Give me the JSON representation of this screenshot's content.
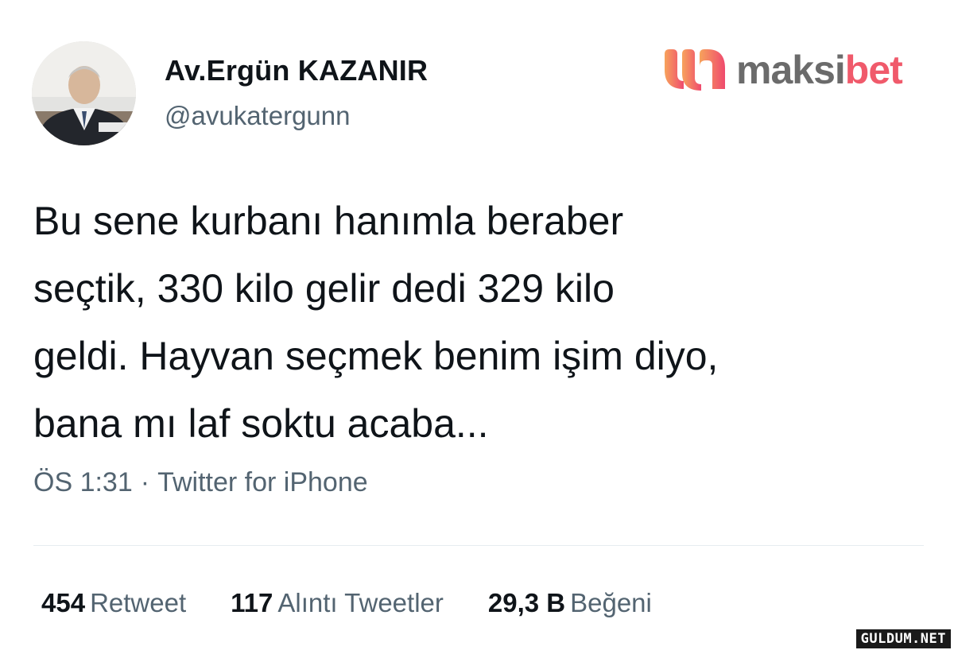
{
  "tweet": {
    "author": {
      "display_name": "Av.Ergün KAZANIR",
      "handle": "@avukatergunn"
    },
    "text": "Bu sene kurbanı hanımla beraber\nseçtik, 330 kilo gelir dedi 329 kilo\ngeldi. Hayvan seçmek benim işim diyo,\nbana mı laf soktu acaba...",
    "time": "ÖS 1:31",
    "separator": "·",
    "source": "Twitter for iPhone",
    "stats": {
      "retweets": {
        "count": "454",
        "label": "Retweet"
      },
      "quotes": {
        "count": "117",
        "label": "Alıntı Tweetler"
      },
      "likes": {
        "count": "29,3 B",
        "label": "Beğeni"
      }
    }
  },
  "brand": {
    "name_part1": "maksi",
    "name_part2": "bet",
    "icon": "maksibet-logo-icon",
    "colors": {
      "text": "#6b6b6b",
      "accent": "#f05a6b",
      "icon_gradient_start": "#f7a35c",
      "icon_gradient_end": "#ef4a6e"
    }
  },
  "watermark": {
    "text": "GULDUM.NET"
  }
}
